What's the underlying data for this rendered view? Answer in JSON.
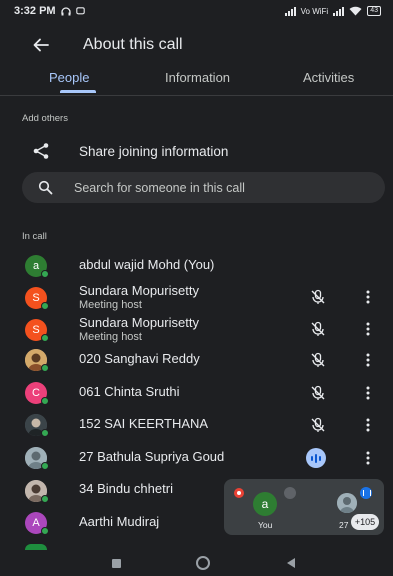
{
  "status_bar": {
    "time": "3:32 PM",
    "network_label": "Vo WiFi",
    "battery": "43"
  },
  "app_bar": {
    "title": "About this call",
    "back_icon": "arrow-back-icon"
  },
  "tabs": [
    {
      "label": "People",
      "active": true
    },
    {
      "label": "Information",
      "active": false
    },
    {
      "label": "Activities",
      "active": false
    }
  ],
  "add_others": {
    "section_label": "Add others",
    "share_label": "Share joining information",
    "share_icon": "share-icon"
  },
  "search": {
    "placeholder": "Search for someone in this call",
    "value": ""
  },
  "in_call": {
    "section_label": "In call",
    "participants": [
      {
        "name": "abdul wajid Mohd (You)",
        "subtitle": "",
        "avatar_letter": "a",
        "avatar_color": "#2e7d32",
        "state": "none"
      },
      {
        "name": "Sundara Mopurisetty",
        "subtitle": "Meeting host",
        "avatar_letter": "S",
        "avatar_color": "#f4511e",
        "state": "muted"
      },
      {
        "name": "Sundara Mopurisetty",
        "subtitle": "Meeting host",
        "avatar_letter": "S",
        "avatar_color": "#f4511e",
        "state": "muted"
      },
      {
        "name": "020 Sanghavi Reddy",
        "subtitle": "",
        "avatar_letter": "",
        "avatar_color": "#c9a27a",
        "state": "muted"
      },
      {
        "name": "061 Chinta Sruthi",
        "subtitle": "",
        "avatar_letter": "C",
        "avatar_color": "#ec407a",
        "state": "muted"
      },
      {
        "name": "152 SAI KEERTHANA",
        "subtitle": "",
        "avatar_letter": "",
        "avatar_color": "#4f5b62",
        "state": "muted"
      },
      {
        "name": "27 Bathula Supriya Goud",
        "subtitle": "",
        "avatar_letter": "",
        "avatar_color": "#8d9ba3",
        "state": "speaking"
      },
      {
        "name": "34 Bindu chhetri",
        "subtitle": "",
        "avatar_letter": "",
        "avatar_color": "#b0a39a",
        "state": "none"
      },
      {
        "name": "Aarthi Mudiraj",
        "subtitle": "",
        "avatar_letter": "A",
        "avatar_color": "#ab47bc",
        "state": "none"
      }
    ]
  },
  "pip": {
    "you_letter": "a",
    "you_label": "You",
    "other_label": "27",
    "overflow_count": "+105"
  },
  "colors": {
    "background": "#1e1f22",
    "accent": "#a8c7fa",
    "surface": "#2f3033"
  }
}
